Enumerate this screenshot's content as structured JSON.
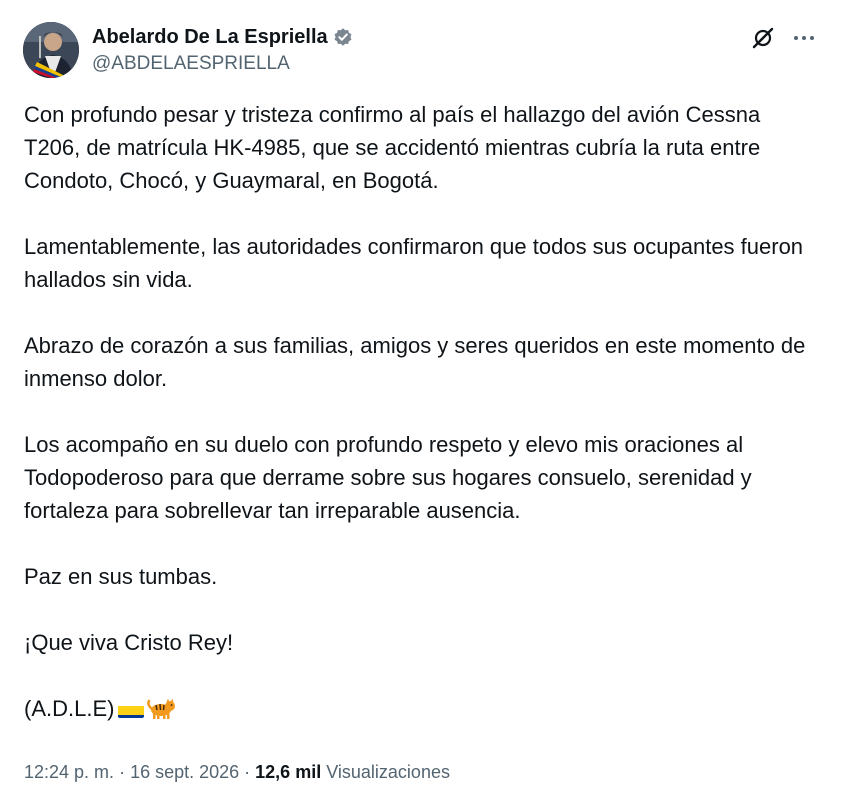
{
  "author": {
    "display_name": "Abelardo De La Espriella",
    "handle": "@ABDELAESPRIELLA",
    "verified": true
  },
  "icons": {
    "verified": "verified-badge-icon",
    "grok": "grok-icon",
    "more": "more-options-icon",
    "flag": "colombia-flag-emoji",
    "tiger": "tiger-emoji"
  },
  "tweet": {
    "paragraphs": [
      "Con profundo pesar y tristeza confirmo al país el hallazgo del avión Cessna T206, de matrícula HK-4985, que se accidentó mientras cubría la ruta entre Condoto, Chocó, y Guaymaral, en Bogotá.",
      "Lamentablemente, las autoridades confirmaron que todos sus ocupantes fueron hallados sin vida.",
      "Abrazo de corazón a sus familias, amigos y seres queridos en este momento de inmenso dolor.",
      "Los acompaño en su duelo con profundo respeto y elevo mis oraciones al Todopoderoso para que derrame sobre sus hogares consuelo, serenidad y fortaleza para sobrellevar tan irreparable ausencia.",
      "Paz en sus tumbas.",
      "¡Que viva Cristo Rey!"
    ],
    "signature": "(A.D.L.E)"
  },
  "meta": {
    "time": "12:24 p. m.",
    "separator": " · ",
    "date": "16 sept. 2026",
    "views_count": "12,6 mil",
    "views_label": "Visualizaciones"
  },
  "colors": {
    "text": "#0f1419",
    "secondary": "#536471",
    "verified_badge": "#7a8590"
  }
}
